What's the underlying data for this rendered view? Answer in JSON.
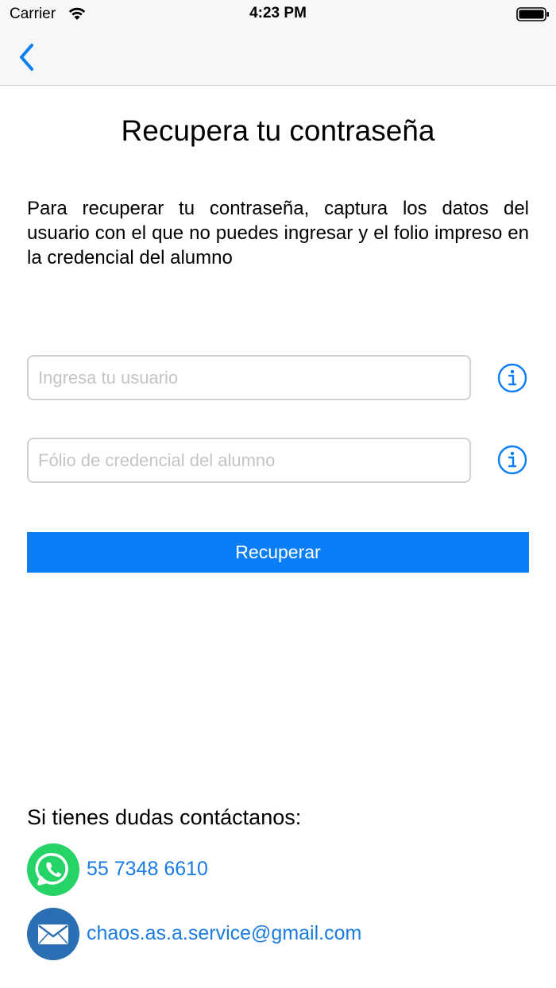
{
  "status_bar": {
    "carrier": "Carrier",
    "time": "4:23 PM"
  },
  "nav": {
    "back_icon": "chevron-left-icon"
  },
  "page": {
    "title": "Recupera tu contraseña",
    "description": "Para recuperar tu contraseña, captura los datos del usuario con el que no puedes ingresar y el folio impreso en la credencial del alumno"
  },
  "form": {
    "user_input": {
      "value": "",
      "placeholder": "Ingresa tu usuario"
    },
    "folio_input": {
      "value": "",
      "placeholder": "Fólio de credencial del alumno"
    },
    "info_icon": "info-circle-icon",
    "submit_label": "Recuperar"
  },
  "contact": {
    "heading": "Si tienes dudas contáctanos:",
    "phone": "55 7348 6610",
    "email": "chaos.as.a.service@gmail.com"
  },
  "colors": {
    "accent": "#0a7ef7",
    "link": "#1a7be0",
    "whatsapp": "#25d366",
    "mail": "#2a6fb3",
    "nav_background": "#f7f7f7"
  }
}
